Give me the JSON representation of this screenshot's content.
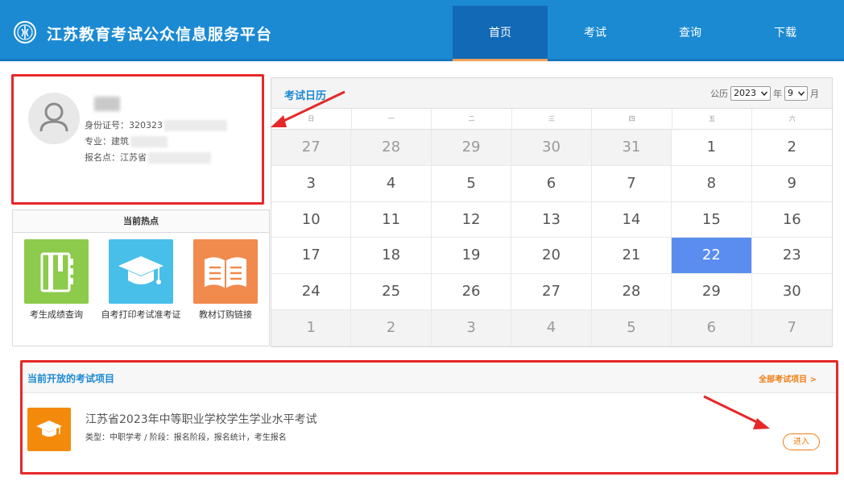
{
  "header": {
    "site_title": "江苏教育考试公众信息服务平台",
    "nav": [
      {
        "label": "首页",
        "active": true
      },
      {
        "label": "考试",
        "active": false
      },
      {
        "label": "查询",
        "active": false
      },
      {
        "label": "下载",
        "active": false
      }
    ]
  },
  "user": {
    "name": "",
    "id_label": "身份证号：",
    "id_value": "320323",
    "major_label": "专业：",
    "major_value": "建筑",
    "site_label": "报名点：",
    "site_value": "江苏省"
  },
  "hot": {
    "title": "当前热点",
    "items": [
      {
        "label": "考生成绩查询",
        "icon": "notebook-icon",
        "color": "#8dcb4c"
      },
      {
        "label": "自考打印考试准考证",
        "icon": "graduation-cap-icon",
        "color": "#48bfe9"
      },
      {
        "label": "教材订购链接",
        "icon": "open-book-icon",
        "color": "#f08a4d"
      }
    ]
  },
  "calendar": {
    "title": "考试日历",
    "era_label": "公历",
    "year": "2023",
    "year_unit": "年",
    "month": "9",
    "month_unit": "月",
    "weekdays": [
      "日",
      "一",
      "二",
      "三",
      "四",
      "五",
      "六"
    ],
    "days": [
      {
        "d": "27",
        "other": true
      },
      {
        "d": "28",
        "other": true
      },
      {
        "d": "29",
        "other": true
      },
      {
        "d": "30",
        "other": true
      },
      {
        "d": "31",
        "other": true
      },
      {
        "d": "1"
      },
      {
        "d": "2"
      },
      {
        "d": "3"
      },
      {
        "d": "4"
      },
      {
        "d": "5"
      },
      {
        "d": "6"
      },
      {
        "d": "7"
      },
      {
        "d": "8"
      },
      {
        "d": "9"
      },
      {
        "d": "10"
      },
      {
        "d": "11"
      },
      {
        "d": "12"
      },
      {
        "d": "13"
      },
      {
        "d": "14"
      },
      {
        "d": "15"
      },
      {
        "d": "16"
      },
      {
        "d": "17"
      },
      {
        "d": "18"
      },
      {
        "d": "19"
      },
      {
        "d": "20"
      },
      {
        "d": "21"
      },
      {
        "d": "22",
        "today": true
      },
      {
        "d": "23"
      },
      {
        "d": "24"
      },
      {
        "d": "25"
      },
      {
        "d": "26"
      },
      {
        "d": "27"
      },
      {
        "d": "28"
      },
      {
        "d": "29"
      },
      {
        "d": "30"
      },
      {
        "d": "1",
        "other": true
      },
      {
        "d": "2",
        "other": true
      },
      {
        "d": "3",
        "other": true
      },
      {
        "d": "4",
        "other": true
      },
      {
        "d": "5",
        "other": true
      },
      {
        "d": "6",
        "other": true
      },
      {
        "d": "7",
        "other": true
      }
    ]
  },
  "exams": {
    "title": "当前开放的考试项目",
    "all_link": "全部考试项目 >",
    "items": [
      {
        "name": "江苏省2023年中等职业学校学生学业水平考试",
        "meta": "类型：中职学考 / 阶段：报名阶段，报名统计，考生报名",
        "enter_label": "进入"
      }
    ]
  },
  "colors": {
    "header": "#1b8ad3",
    "nav_active": "#1269b6",
    "accent_orange": "#ef7d14",
    "today": "#5b8df0",
    "annotation_red": "#e62828"
  }
}
